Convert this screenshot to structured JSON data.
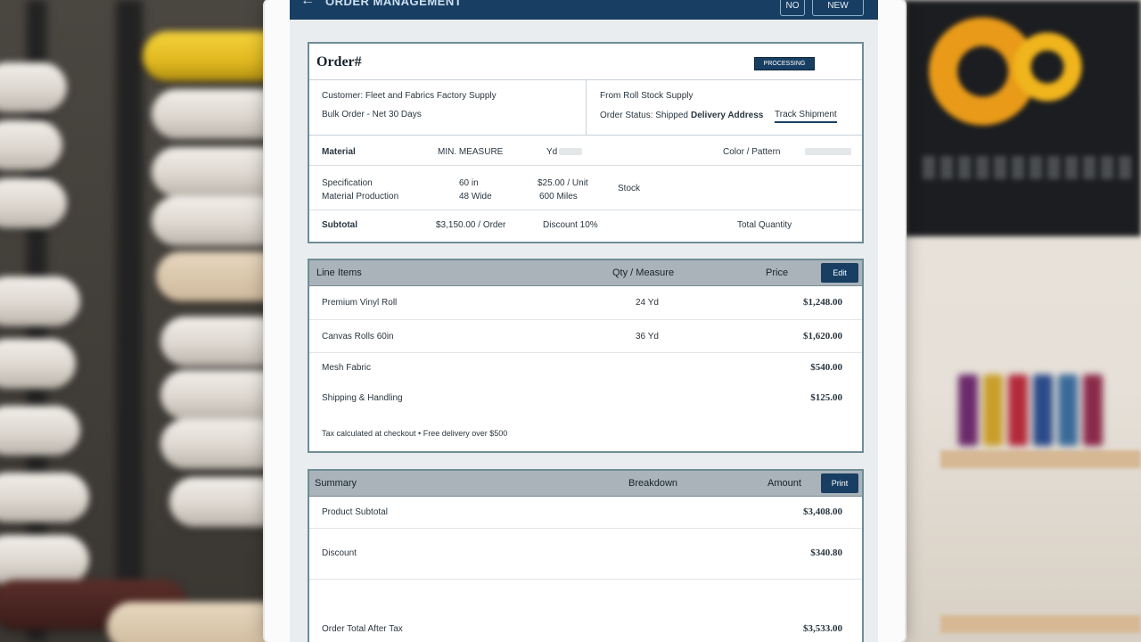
{
  "app": {
    "title": "ORDER MANAGEMENT",
    "back_icon": "arrow-left-icon",
    "buttons": [
      "NO",
      "NEW"
    ]
  },
  "order": {
    "title": "Order#",
    "status_badge": "PROCESSING",
    "info_left": [
      "Customer: Fleet and Fabrics Factory Supply",
      "Bulk Order - Net 30 Days"
    ],
    "info_right_title": "From Roll Stock Supply",
    "info_right_items": [
      "Order Status: Shipped",
      "Delivery Address",
      "Track Shipment"
    ],
    "rows": [
      {
        "label": "Material",
        "qty": "MIN. MEASURE",
        "unit": "Yd",
        "extra": "Color / Pattern"
      },
      {
        "label": "Specification",
        "sub": "Material Production",
        "qty": "60 in",
        "qty2": "48 Wide",
        "unit": "$25.00 / Unit",
        "unit2": "600 Miles",
        "extra": "Stock"
      },
      {
        "label": "Subtotal",
        "qty": "$3,150.00 / Order",
        "unit": "Discount 10%",
        "extra": "Total Quantity"
      }
    ]
  },
  "items": {
    "header": {
      "name": "Line Items",
      "qty": "Qty / Measure",
      "price": "Price",
      "action": "Edit"
    },
    "rows": [
      {
        "name": "Premium Vinyl Roll",
        "qty": "24 Yd",
        "price": "$1,248.00"
      },
      {
        "name": "Canvas Rolls 60in",
        "qty": "36 Yd",
        "price": "$1,620.00"
      },
      {
        "name": "Mesh Fabric",
        "qty": "",
        "price": "$540.00"
      },
      {
        "name": "Shipping & Handling",
        "qty": "",
        "price": "$125.00"
      }
    ],
    "footer": "Tax calculated at checkout • Free delivery over $500"
  },
  "summary": {
    "header": {
      "name": "Summary",
      "col": "Breakdown",
      "price": "Amount",
      "action": "Print"
    },
    "rows": [
      {
        "name": "Product Subtotal",
        "price": "$3,408.00"
      },
      {
        "name": "Discount",
        "price": "$340.80"
      },
      {
        "name": "Order Total After Tax",
        "price": "$3,533.00"
      }
    ]
  }
}
